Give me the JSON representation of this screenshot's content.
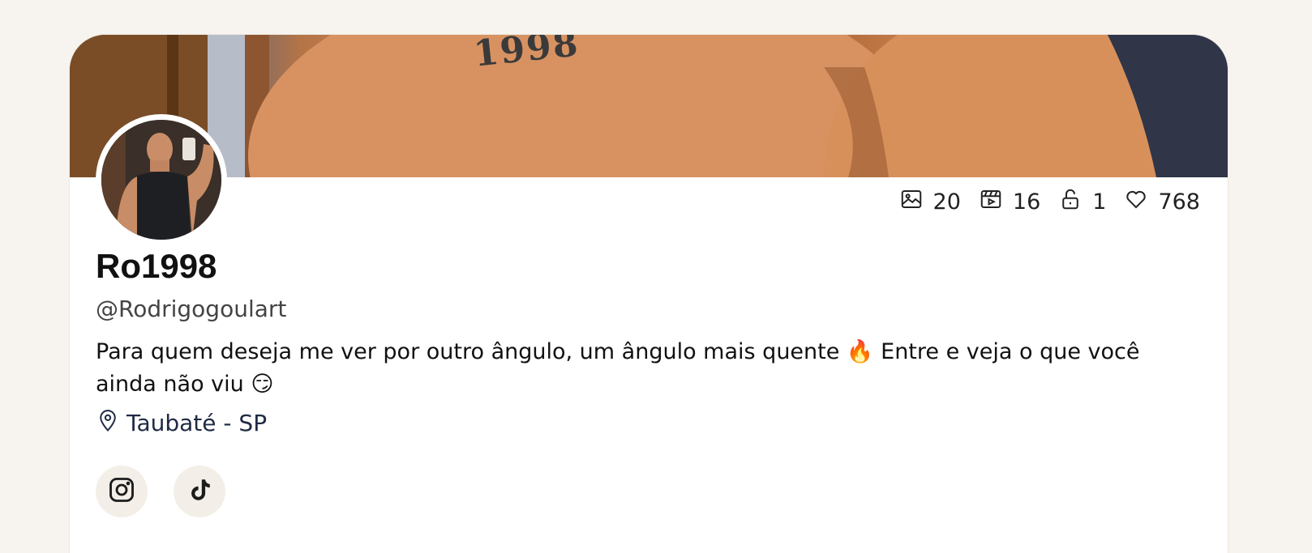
{
  "profile": {
    "display_name": "Ro1998",
    "handle": "@Rodrigogoulart",
    "bio_text": "Para quem deseja me ver por outro ângulo, um ângulo mais quente 🔥 Entre e veja o que você ainda não viu 😏",
    "location": "Taubaté - SP",
    "cover_tattoo_text": "1998"
  },
  "stats": {
    "photos": "20",
    "videos": "16",
    "locked": "1",
    "likes": "768"
  },
  "socials": {
    "items": [
      "instagram-icon",
      "tiktok-icon"
    ]
  },
  "colors": {
    "background": "#f7f4ef",
    "card": "#ffffff",
    "social_button_bg": "#f3efe8"
  }
}
